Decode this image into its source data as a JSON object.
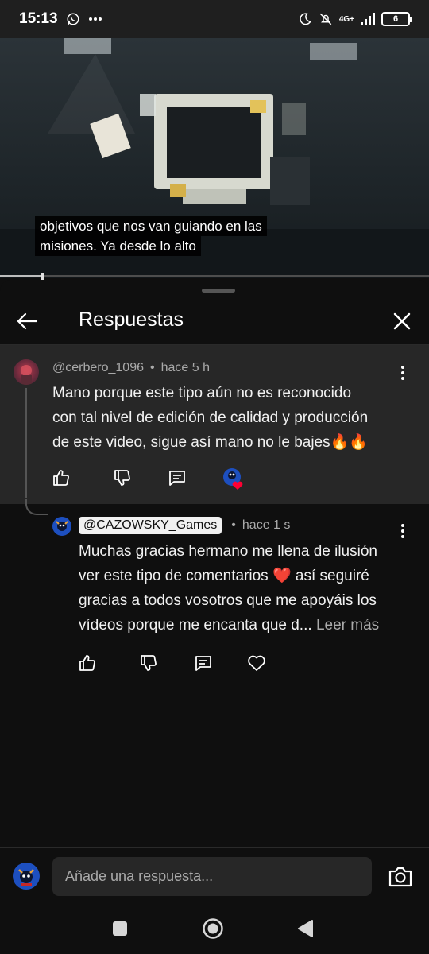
{
  "status_bar": {
    "time": "15:13",
    "network": "4G+",
    "battery": "6",
    "icons": [
      "whatsapp-icon",
      "more-dots-icon",
      "moon-icon",
      "muted-icon",
      "signal-icon",
      "battery-icon"
    ]
  },
  "video": {
    "subtitle_line1": "objetivos que nos van guiando en las",
    "subtitle_line2": "misiones. Ya desde lo alto",
    "progress_fraction": 0.1
  },
  "panel": {
    "title": "Respuestas"
  },
  "parent_comment": {
    "author": "@cerbero_1096",
    "time": "hace 5 h",
    "text_line1": "Mano porque este tipo aún no es reconocido",
    "text_line2": "con tal nivel de edición de calidad y producción",
    "text_line3": "de este video, sigue así mano no le bajes🔥🔥"
  },
  "reply": {
    "author": "@CAZOWSKY_Games",
    "time": "hace 1 s",
    "text_line1": "Muchas gracias hermano me llena de ilusión",
    "text_line2": "ver este tipo de comentarios ❤️ así seguiré",
    "text_line3": "gracias a todos vosotros que me apoyáis los",
    "text_line4": "vídeos porque me encanta que d...",
    "read_more": "Leer más"
  },
  "composer": {
    "placeholder": "Añade una respuesta..."
  },
  "colors": {
    "background": "#0f0f0f",
    "highlight_bg": "#272727",
    "text_secondary": "#aaaaaa",
    "heart_red": "#ff0033"
  }
}
